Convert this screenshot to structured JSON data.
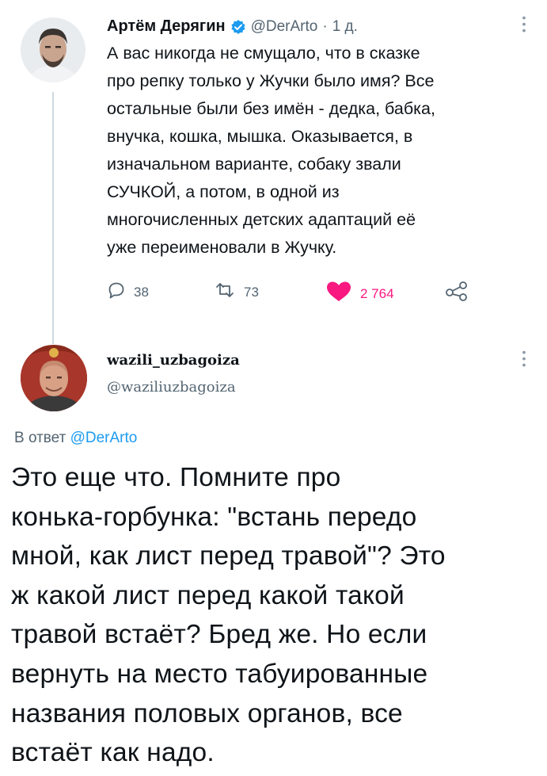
{
  "tweet": {
    "author_name": "Артём Дерягин",
    "handle": "@DerArto",
    "separator": "·",
    "time": "1 д.",
    "text": "А вас никогда не смущало, что в сказке\nпро репку только у Жучки было имя? Все\nостальные были без имён - дедка, бабка,\nвнучка, кошка, мышка. Оказывается, в\nизначальном варианте, собаку звали\nСУЧКОЙ, а потом, в одной из\nмногочисленных детских адаптаций её\nуже переименовали в Жучку.",
    "replies": "38",
    "retweets": "73",
    "likes": "2 764",
    "colors": {
      "like": "#f91880",
      "verified": "#1d9bf0"
    },
    "icons": [
      "verified-badge-icon",
      "reply-icon",
      "retweet-icon",
      "heart-icon",
      "share-icon",
      "more-icon"
    ]
  },
  "reply": {
    "author_name": "wazili_uzbagoiza",
    "handle": "@waziliuzbagoiza",
    "reply_to_prefix": "В ответ",
    "reply_to_handle": "@DerArto",
    "text": "Это еще что. Помните про\nконька-горбунка: \"встань передо\nмной, как лист перед травой\"? Это\nж какой лист перед какой такой\nтравой встаёт? Бред же. Но если\nвернуть на место табуированные\nназвания половых органов, все\nвстаёт как надо.",
    "icons": [
      "more-icon"
    ]
  }
}
